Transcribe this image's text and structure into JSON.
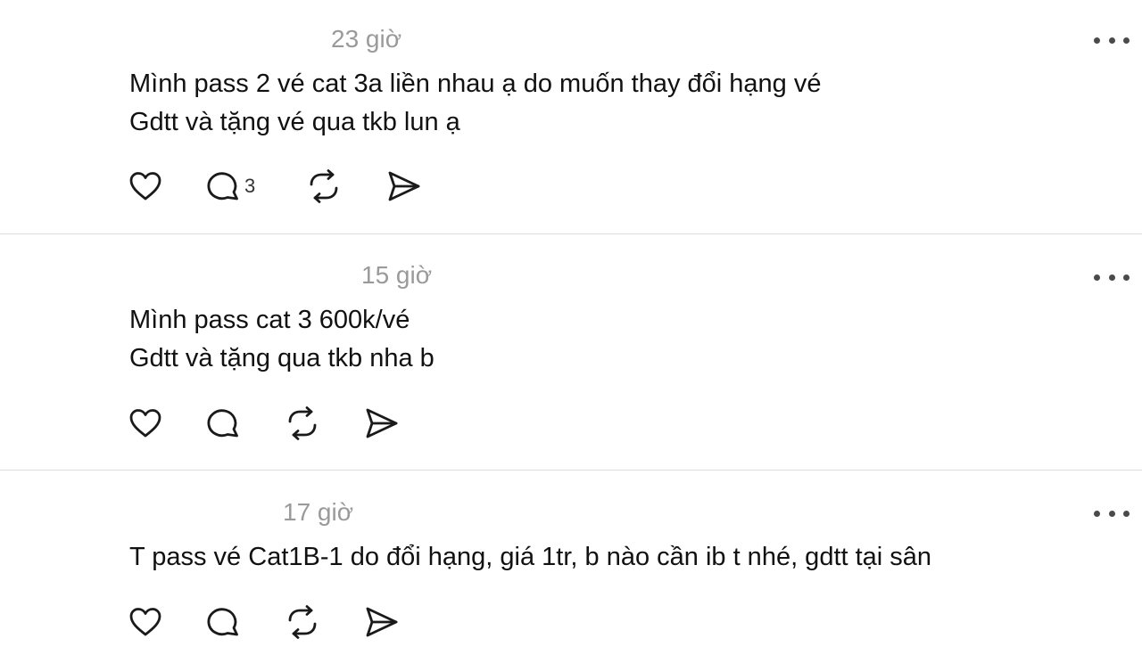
{
  "posts": [
    {
      "time": "23 giờ",
      "lines": [
        "Mình pass 2 vé cat 3a liền nhau ạ do muốn thay đổi hạng vé",
        "Gdtt và tặng vé qua tkb lun ạ"
      ],
      "reply_count": "3"
    },
    {
      "time": "15 giờ",
      "lines": [
        "Mình pass cat 3 600k/vé",
        "Gdtt và tặng qua tkb nha b"
      ],
      "reply_count": ""
    },
    {
      "time": "17 giờ",
      "lines": [
        "T pass vé Cat1B-1 do đổi hạng, giá 1tr, b nào cần ib t nhé, gdtt tại sân"
      ],
      "reply_count": ""
    }
  ],
  "icons": {
    "like": "heart-icon",
    "reply": "comment-icon",
    "repost": "repost-icon",
    "share": "send-icon",
    "more": "more-options-icon"
  },
  "colors": {
    "timestamp": "#9a9a9a",
    "text": "#111111",
    "icon": "#1a1a1a",
    "divider": "#dcdcdc"
  }
}
